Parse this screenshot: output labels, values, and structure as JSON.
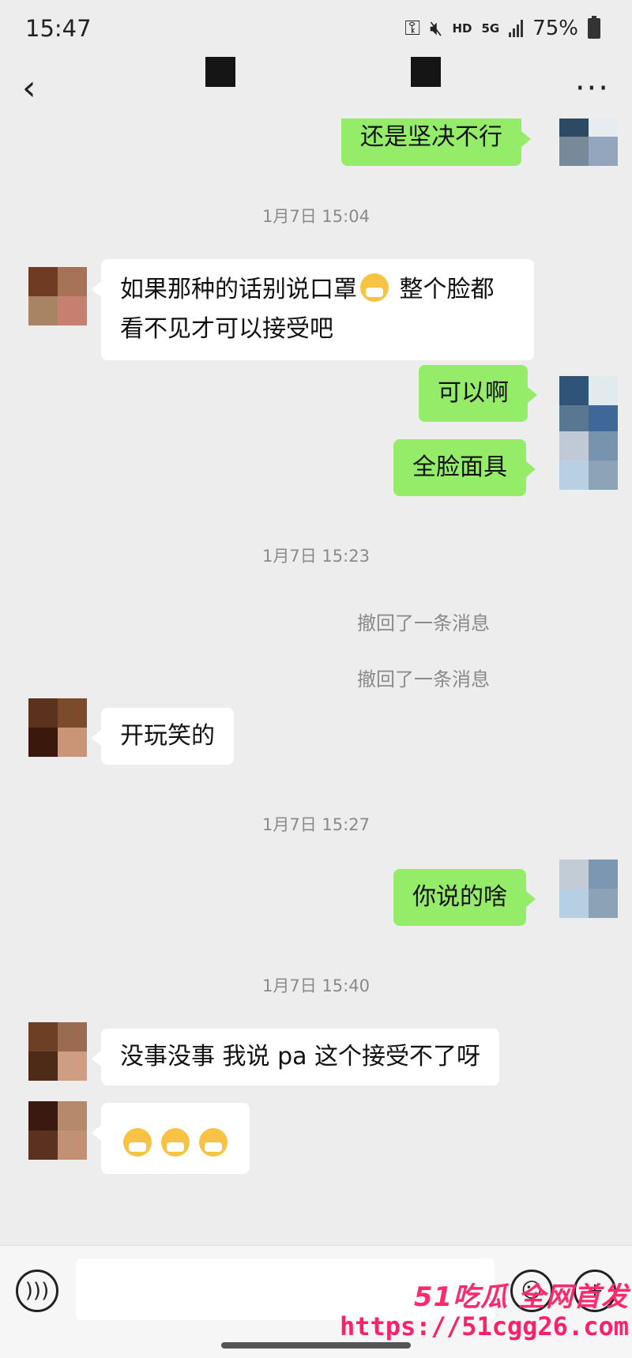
{
  "status_bar": {
    "time": "15:47",
    "hd": "HD",
    "network": "5G",
    "battery": "75%"
  },
  "nav": {
    "back": "‹",
    "more": "···"
  },
  "messages": [
    {
      "type": "out",
      "text": "还是坚决不行"
    },
    {
      "type": "time",
      "text": "1月7日 15:04"
    },
    {
      "type": "in",
      "text": "如果那种的话别说口罩",
      "text2": " 整个脸都看不见才可以接受吧"
    },
    {
      "type": "out",
      "text": "可以啊"
    },
    {
      "type": "out",
      "text": "全脸面具"
    },
    {
      "type": "time",
      "text": "1月7日 15:23"
    },
    {
      "type": "recall",
      "text": "撤回了一条消息"
    },
    {
      "type": "recall",
      "text": "撤回了一条消息"
    },
    {
      "type": "in",
      "text": "开玩笑的"
    },
    {
      "type": "time",
      "text": "1月7日 15:27"
    },
    {
      "type": "out",
      "text": "你说的啥"
    },
    {
      "type": "time",
      "text": "1月7日 15:40"
    },
    {
      "type": "in",
      "text": "没事没事 我说 pa 这个接受不了呀"
    }
  ],
  "icons": {
    "back": "chevron-left-icon",
    "more": "more-dots-icon",
    "voice": "voice-icon",
    "emoji": "emoji-icon",
    "plus": "plus-icon"
  },
  "colors": {
    "outgoing_bubble": "#95ec69",
    "incoming_bubble": "#ffffff",
    "background": "#ededed"
  },
  "watermark": {
    "logo": "51吃瓜 全网首发",
    "url": "https://51cgg26.com"
  }
}
